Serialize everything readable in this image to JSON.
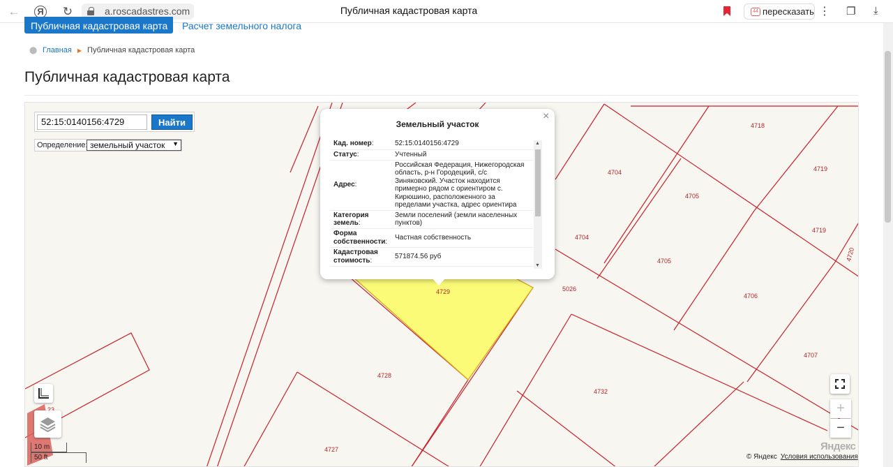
{
  "browser": {
    "url": "a.roscadastres.com",
    "tab_title": "Публичная кадастровая карта",
    "retell_label": "пересказать",
    "retell_badge": "44",
    "bookmark_color": "#e32636"
  },
  "site": {
    "tabs": [
      "Публичная кадастровая карта",
      "Расчет земельного налога"
    ],
    "breadcrumb": {
      "home": "Главная",
      "current": "Публичная кадастровая карта"
    },
    "page_title": "Публичная кадастровая карта",
    "accent_color": "#1a77c9"
  },
  "search": {
    "value": "52:15:0140156:4729",
    "button_label": "Найти",
    "definition_label": "Определение:",
    "definition_value": "земельный участок"
  },
  "popup": {
    "title": "Земельный участок",
    "rows": [
      {
        "key": "Кад. номер",
        "value": "52:15:0140156:4729"
      },
      {
        "key": "Статус",
        "value": "Учтенный"
      },
      {
        "key": "Адрес",
        "value": "Российская Федерация, Нижегородская область, р-н Городецкий, с/с Зиняковский. Участок находится примерно рядом с ориентиром с. Кирюшино, расположенного за пределами участка, адрес ориентира"
      },
      {
        "key": "Категория земель",
        "value": "Земли поселений (земли населенных пунктов)"
      },
      {
        "key": "Форма собственности",
        "value": "Частная собственность"
      },
      {
        "key": "Кадастровая стоимость",
        "value": "571874.56 руб"
      }
    ]
  },
  "map": {
    "parcel_numbers": [
      "4718",
      "4704",
      "4719",
      "4705",
      "4719",
      "4720",
      "4704",
      "4705",
      "5026",
      "4706",
      "4729",
      "4707",
      "4728",
      "4732",
      "4727",
      "23"
    ],
    "highlight_color": "#fbfb78",
    "line_color": "#c9202a",
    "scale_m": "10 m",
    "scale_ft": "50 ft",
    "copyright": "© Яндекс",
    "terms": "Условия использования",
    "logo": "Яндекс",
    "zoom_in": "+",
    "zoom_out": "−"
  }
}
